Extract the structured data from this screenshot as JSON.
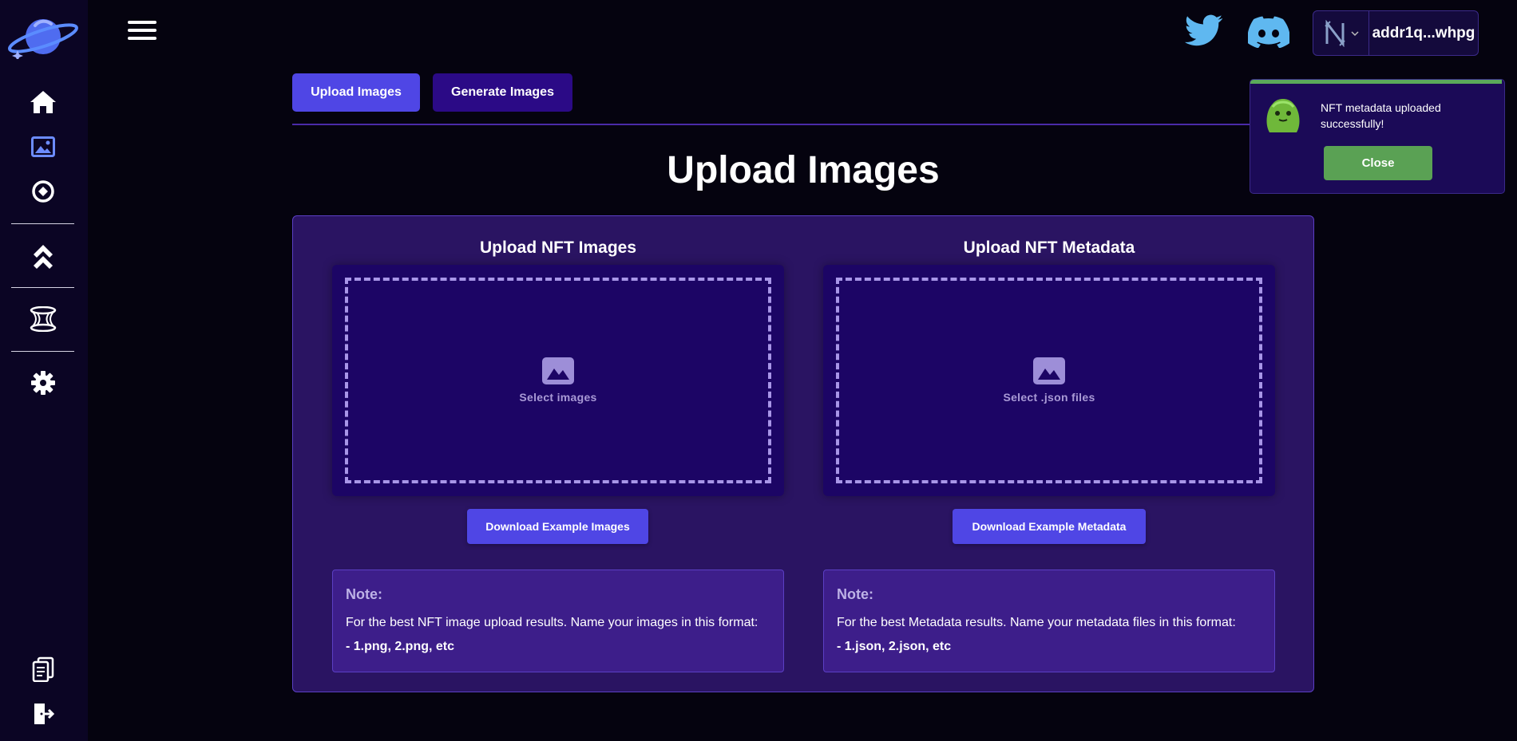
{
  "sidebar": {
    "icons": [
      "planet-logo-icon",
      "home-icon",
      "image-icon",
      "circle-dot-icon",
      "chevrons-up-icon",
      "portal-icon",
      "gear-icon",
      "documents-icon",
      "logout-icon"
    ]
  },
  "header": {
    "wallet": {
      "address": "addr1q...whpg",
      "network_icon": "n-logo-icon"
    }
  },
  "tabs": [
    {
      "label": "Upload Images",
      "active": true
    },
    {
      "label": "Generate Images",
      "active": false
    }
  ],
  "main": {
    "title": "Upload Images",
    "images": {
      "title": "Upload NFT Images",
      "dropzone_label": "Select images",
      "download_label": "Download Example Images",
      "note_title": "Note:",
      "note_text": "For the best NFT image upload results. Name your images in this format:",
      "note_example": "- 1.png, 2.png, etc"
    },
    "metadata": {
      "title": "Upload NFT Metadata",
      "dropzone_label": "Select .json files",
      "download_label": "Download Example Metadata",
      "note_title": "Note:",
      "note_text": "For the best Metadata results. Name your metadata files in this format:",
      "note_example": "- 1.json, 2.json, etc"
    }
  },
  "toast": {
    "message": "NFT metadata uploaded successfully!",
    "close_label": "Close"
  },
  "colors": {
    "background": "#05030f",
    "sidebar": "#0b0524",
    "accent": "#4f46e5",
    "panel": "#2a1462",
    "success": "#5aa154"
  }
}
